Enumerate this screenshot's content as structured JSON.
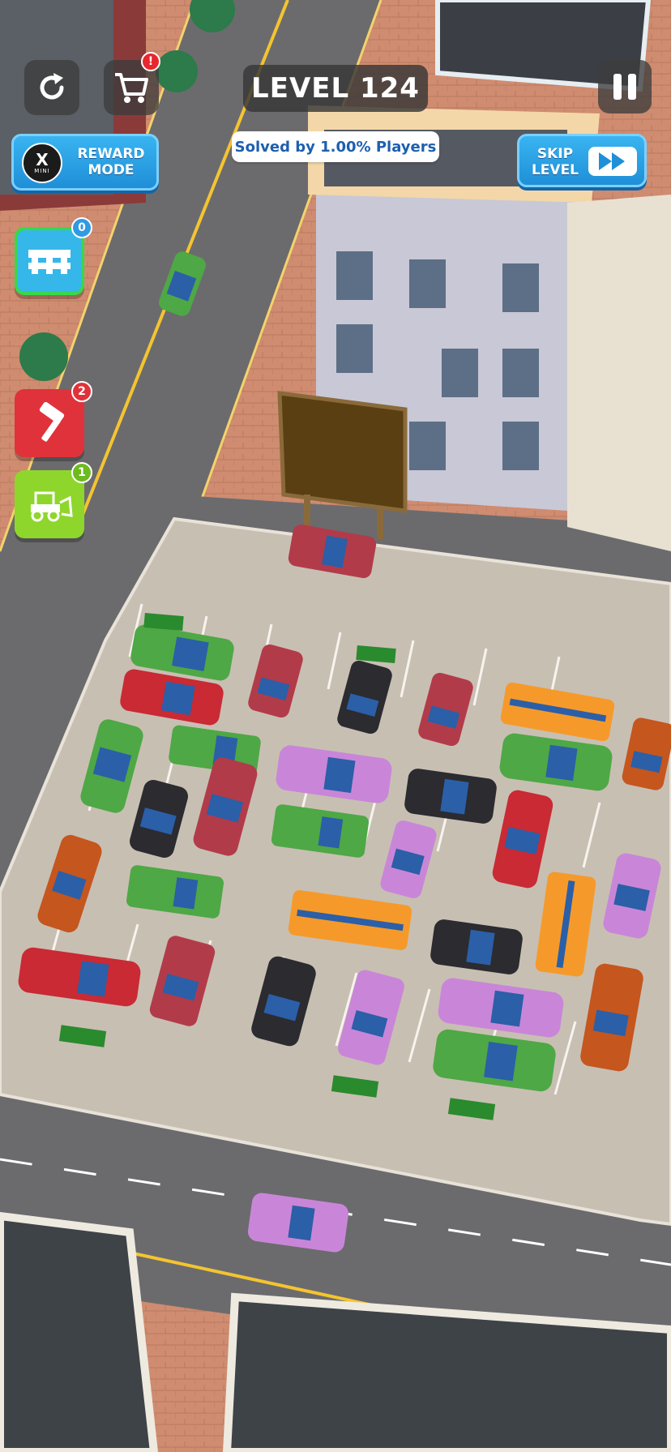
{
  "hud": {
    "level_label": "LEVEL 124",
    "solved_label": "Solved by 1.00% Players",
    "reward_mode_label": "REWARD MODE",
    "reward_icon_letter": "X",
    "reward_icon_sub": "MINI",
    "skip_level_label": "SKIP LEVEL",
    "shop_alert": "!"
  },
  "powerups": [
    {
      "name": "pallet",
      "count": "0",
      "color": "#36b7ea"
    },
    {
      "name": "hammer",
      "count": "2",
      "color": "#e0323a"
    },
    {
      "name": "bulldozer",
      "count": "1",
      "color": "#8ed62c"
    }
  ],
  "colors": {
    "road": "#6b6b6e",
    "parking_lot": "#c8bfb3",
    "sidewalk": "#d4886c",
    "car_red": "#c92a34",
    "car_green": "#4ea845",
    "car_black": "#2b2b30",
    "car_pink": "#c986d8",
    "car_orange": "#f59a2a",
    "car_rust": "#c5561e",
    "car_maroon": "#b23b4a"
  }
}
